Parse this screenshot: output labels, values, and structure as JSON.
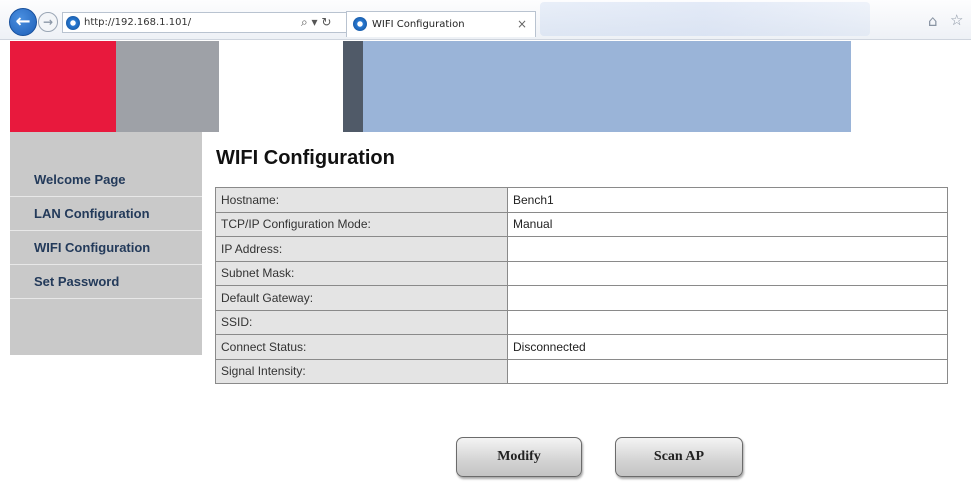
{
  "browser": {
    "url": "http://192.168.1.101/",
    "address_buttons": "⌕ ▾ ↻",
    "tab_title": "WIFI Configuration",
    "tab_close": "×",
    "back_glyph": "←",
    "forward_glyph": "→",
    "home_glyph": "⌂",
    "star_glyph": "☆"
  },
  "sidebar": {
    "items": [
      {
        "label": "Welcome Page"
      },
      {
        "label": "LAN Configuration"
      },
      {
        "label": "WIFI Configuration"
      },
      {
        "label": "Set Password"
      }
    ]
  },
  "main": {
    "title": "WIFI Configuration",
    "rows": [
      {
        "label": "Hostname:",
        "value": "Bench1"
      },
      {
        "label": "TCP/IP Configuration Mode:",
        "value": "Manual"
      },
      {
        "label": "IP Address:",
        "value": ""
      },
      {
        "label": "Subnet Mask:",
        "value": ""
      },
      {
        "label": "Default Gateway:",
        "value": ""
      },
      {
        "label": "SSID:",
        "value": ""
      },
      {
        "label": "Connect Status:",
        "value": "Disconnected"
      },
      {
        "label": "Signal Intensity:",
        "value": ""
      }
    ],
    "modify_label": "Modify",
    "scan_label": "Scan AP"
  },
  "colors": {
    "banner_red": "#e8193d",
    "banner_gray": "#9ea1a7",
    "banner_blue": "#9ab4d8",
    "sidebar_bg": "#c9c9c9",
    "sidebar_text": "#233a5a"
  }
}
